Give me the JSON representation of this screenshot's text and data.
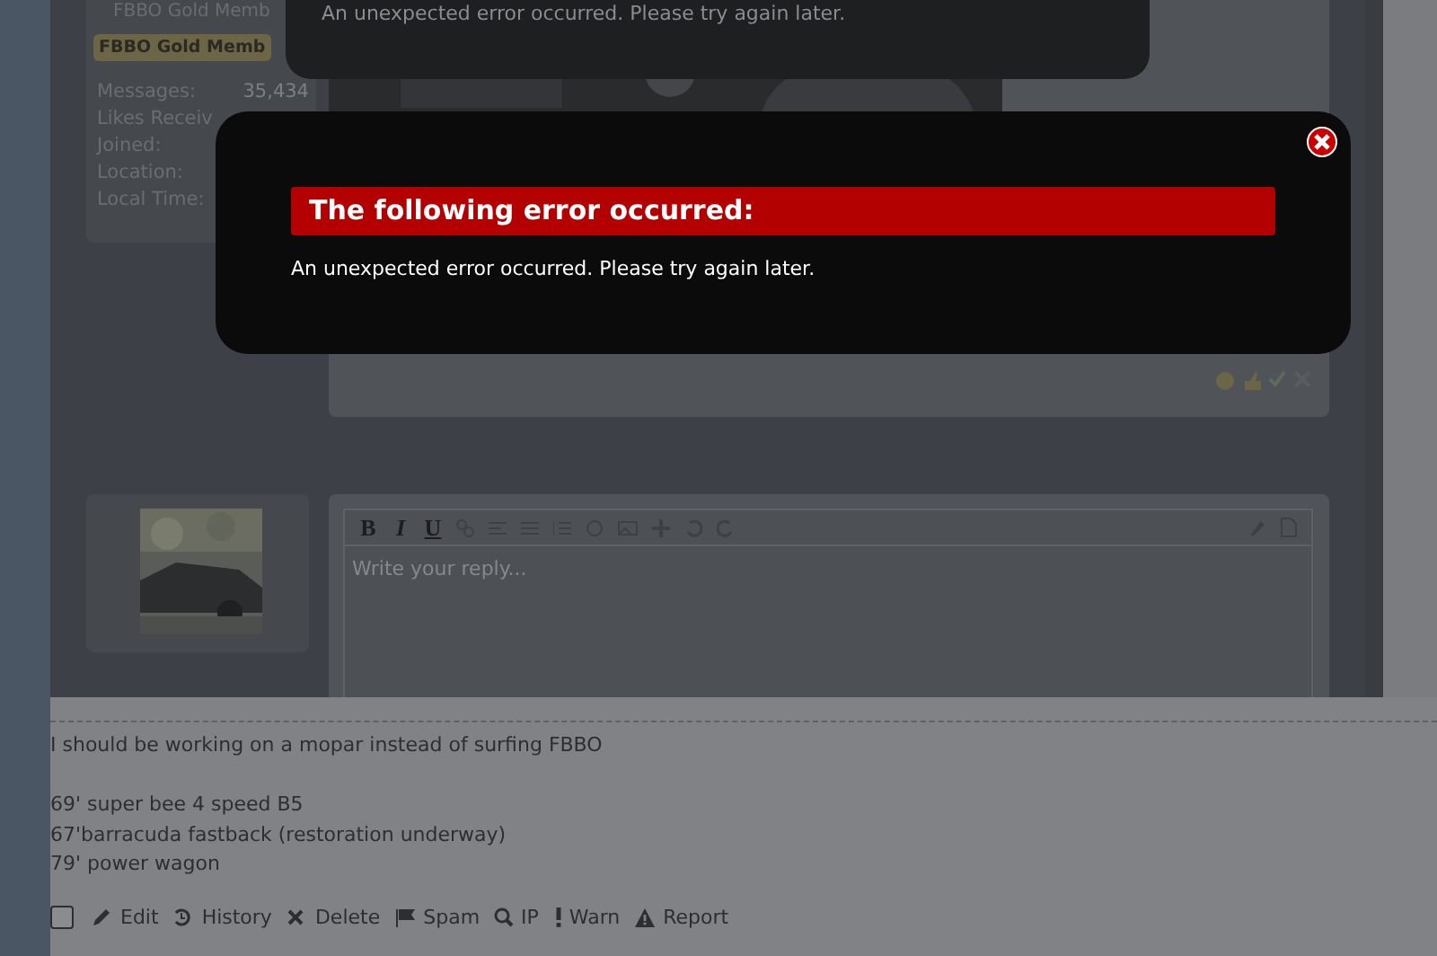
{
  "member_card": {
    "rank": "FBBO Gold Memb",
    "banner": "FBBO Gold Memb",
    "stats": [
      {
        "label": "Messages:",
        "value": "35,434"
      },
      {
        "label": "Likes Receiv"
      },
      {
        "label": "Joined:"
      },
      {
        "label": "Location:"
      },
      {
        "label": "Local Time:"
      }
    ]
  },
  "background_dialog": {
    "message": "An unexpected error occurred. Please try again later."
  },
  "error_dialog": {
    "title": "The following error occurred:",
    "message": "An unexpected error occurred. Please try again later."
  },
  "reply_editor": {
    "toolbar": [
      "B",
      "I",
      "U"
    ],
    "placeholder": "Write your reply..."
  },
  "signature": {
    "paragraphs": [
      [
        "I should be working on a mopar instead of surfing FBBO"
      ],
      [
        "69' super bee 4 speed B5",
        "67'barracuda fastback (restoration underway)",
        "79' power wagon"
      ]
    ]
  },
  "actions": [
    {
      "kind": "checkbox",
      "checked": false
    },
    {
      "kind": "edit",
      "label": "Edit"
    },
    {
      "kind": "history",
      "label": "History"
    },
    {
      "kind": "delete",
      "label": "Delete"
    },
    {
      "kind": "spam",
      "label": "Spam"
    },
    {
      "kind": "ip",
      "label": "IP"
    },
    {
      "kind": "warn",
      "label": "Warn"
    },
    {
      "kind": "report",
      "label": "Report"
    }
  ]
}
